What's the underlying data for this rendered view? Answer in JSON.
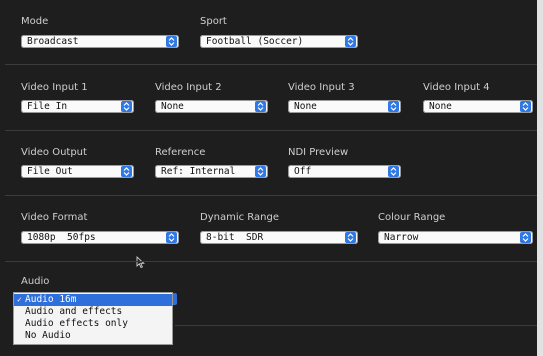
{
  "mode": {
    "label": "Mode",
    "value": "Broadcast"
  },
  "sport": {
    "label": "Sport",
    "value": "Football (Soccer)"
  },
  "video_inputs": [
    {
      "label": "Video Input 1",
      "value": "File In"
    },
    {
      "label": "Video Input 2",
      "value": "None"
    },
    {
      "label": "Video Input 3",
      "value": "None"
    },
    {
      "label": "Video Input 4",
      "value": "None"
    }
  ],
  "video_output": {
    "label": "Video Output",
    "value": "File Out"
  },
  "reference": {
    "label": "Reference",
    "value": "Ref: Internal"
  },
  "ndi_preview": {
    "label": "NDI Preview",
    "value": "Off"
  },
  "video_format": {
    "label": "Video Format",
    "value": "1080p  50fps"
  },
  "dynamic_range": {
    "label": "Dynamic Range",
    "value": "8-bit  SDR"
  },
  "colour_range": {
    "label": "Colour Range",
    "value": "Narrow"
  },
  "audio": {
    "label": "Audio",
    "selected": "Audio 16m",
    "options": [
      "Audio 16m",
      "Audio and effects",
      "Audio effects only",
      "No Audio"
    ]
  },
  "colors": {
    "accent": "#2f78e6",
    "background": "#1e1e1e",
    "selected_item": "#2f6fdc"
  }
}
